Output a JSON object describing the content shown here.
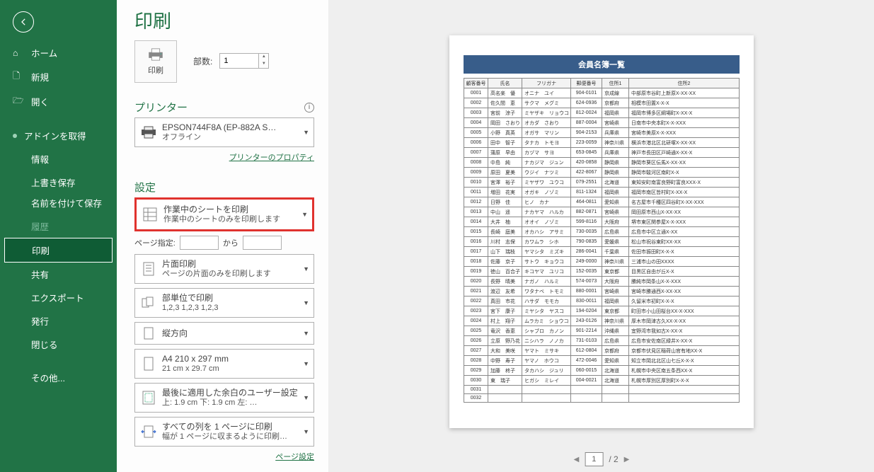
{
  "page_title": "印刷",
  "sidebar": {
    "home": "ホーム",
    "new": "新規",
    "open": "開く",
    "addin": "アドインを取得",
    "info": "情報",
    "save": "上書き保存",
    "saveas": "名前を付けて保存",
    "history": "履歴",
    "print": "印刷",
    "share": "共有",
    "export": "エクスポート",
    "publish": "発行",
    "close": "閉じる",
    "other": "その他..."
  },
  "print_button_label": "印刷",
  "copies": {
    "label": "部数:",
    "value": "1"
  },
  "printer_section": "プリンター",
  "printer": {
    "name": "EPSON744F8A (EP-882A S…",
    "status": "オフライン"
  },
  "printer_props_link": "プリンターのプロパティ",
  "settings_section": "設定",
  "print_what": {
    "l1": "作業中のシートを印刷",
    "l2": "作業中のシートのみを印刷します"
  },
  "pages": {
    "label": "ページ指定:",
    "from": "",
    "to_word": "から",
    "to": ""
  },
  "duplex": {
    "l1": "片面印刷",
    "l2": "ページの片面のみを印刷します"
  },
  "collate": {
    "l1": "部単位で印刷",
    "l2": "1,2,3     1,2,3     1,2,3"
  },
  "orientation": {
    "l1": "縦方向",
    "l2": ""
  },
  "paper": {
    "l1": "A4 210 x 297 mm",
    "l2": "21 cm x 29.7 cm"
  },
  "margins": {
    "l1": "最後に適用した余白のユーザー設定",
    "l2": "上: 1.9 cm 下: 1.9 cm 左: …"
  },
  "scaling": {
    "l1": "すべての列を 1 ページに印刷",
    "l2": "幅が 1 ページに収まるように印刷…"
  },
  "page_setup_link": "ページ設定",
  "pager": {
    "current": "1",
    "total": "2"
  },
  "doc": {
    "title": "会員名簿一覧",
    "headers": [
      "顧客番号",
      "氏名",
      "フリガナ",
      "郵便番号",
      "住所1",
      "住所2"
    ],
    "rows": [
      [
        "0001",
        "高名楽　優",
        "オニナ　ユイ",
        "904-0101",
        "京成線",
        "中部原市谷町上新原X-XX-XX"
      ],
      [
        "0002",
        "佐久間　恵",
        "サクマ　メグミ",
        "624-0936",
        "京都府",
        "相模市田置X-X-X"
      ],
      [
        "0003",
        "宮前　涼子",
        "ミヤザキ　リョウコ",
        "812-0024",
        "福岡県",
        "福岡市博多区綱場町X-XX-X"
      ],
      [
        "0004",
        "岡田　さおり",
        "オカダ　さおり",
        "887-0004",
        "宮崎県",
        "日南市中央本町X-X-XXX"
      ],
      [
        "0005",
        "小野　真英",
        "オガサ　マリン",
        "904-2153",
        "兵庫県",
        "宮崎市美原X-X-XXX"
      ],
      [
        "0006",
        "田中　智子",
        "タナカ　トモヨ",
        "223-0059",
        "神奈川県",
        "横浜市港北区北研塚X-XX-XX"
      ],
      [
        "0007",
        "蒲原　早由",
        "カヅマ　サヨ",
        "653-0845",
        "兵庫県",
        "神戸市長田区戸崎通X-XX-X"
      ],
      [
        "0008",
        "中島　純",
        "ナカジマ　ジュン",
        "420-0858",
        "静岡県",
        "静岡市葵区伝馬X-XX-XX"
      ],
      [
        "0009",
        "原田　夏美",
        "ウジイ　ナツミ",
        "422-8067",
        "静岡県",
        "静岡市駿河区南町X-X"
      ],
      [
        "0010",
        "宮澤　裕子",
        "ミヤザワ　ユウコ",
        "079-2551",
        "北海道",
        "東知安町南富良野町富良XXX-X"
      ],
      [
        "0011",
        "増田　花実",
        "オガキ　ノゾミ",
        "811-1324",
        "福岡県",
        "福岡市南区皆村町X-XX-X"
      ],
      [
        "0012",
        "日野　佳",
        "ヒノ　カナ",
        "464-0811",
        "愛知県",
        "名古屋市千種区四谷町X-XX-XXX"
      ],
      [
        "0013",
        "中山　遥",
        "ナカヤマ　ハルカ",
        "882-0871",
        "宮崎県",
        "岡田原市西山X-XX-XX"
      ],
      [
        "0014",
        "大井　柚",
        "オオイ　ノゾミ",
        "599-8116",
        "大阪府",
        "堺市東区関参屋X-X-XXX"
      ],
      [
        "0015",
        "長崎　庭美",
        "オカハシ　アサミ",
        "730-0035",
        "広島県",
        "広島市中区立通X-XX"
      ],
      [
        "0016",
        "川村　志保",
        "カワムラ　シホ",
        "790-0835",
        "愛媛県",
        "松山市祝谷東町XX-XX"
      ],
      [
        "0017",
        "山下　瑞枝",
        "ヤマシタ　ミズキ",
        "286-0041",
        "千葉県",
        "佐田市振田町X-X-X"
      ],
      [
        "0018",
        "佐藤　京子",
        "サトウ　キョウコ",
        "249-0000",
        "神奈川県",
        "三浦市山の田XXXX"
      ],
      [
        "0019",
        "徳山　百合子",
        "キコヤマ　ユリコ",
        "152-0035",
        "東京都",
        "目黒区自由が丘X-X"
      ],
      [
        "0020",
        "長野　晴美",
        "ナガノ　ハルミ",
        "574-0073",
        "大阪府",
        "勝純市岡条山X-X-XXX"
      ],
      [
        "0021",
        "渡辺　友希",
        "ワタナベ　トモミ",
        "880-0001",
        "宮崎県",
        "宮崎市勝通西X-XX-XX"
      ],
      [
        "0022",
        "真田　市花",
        "ハサダ　モモカ",
        "830-0011",
        "福岡県",
        "久留米市初町X-X-X"
      ],
      [
        "0023",
        "宮下　康子",
        "ミヤシタ　ヤスコ",
        "194-0204",
        "東京都",
        "町田市小山田桜台XX-X-XXX"
      ],
      [
        "0024",
        "村上　翔子",
        "ムラカミ　ショウコ",
        "243-0126",
        "神奈川県",
        "厚木市岡津古久XX-X-XX"
      ],
      [
        "0025",
        "竜沢　香恵",
        "シャブロ　カノン",
        "901-2214",
        "沖縄県",
        "宜野湾市我如古X-XX-X"
      ],
      [
        "0026",
        "立原　野乃花",
        "ニシハラ　ノノカ",
        "731-0103",
        "広島県",
        "広島市安佐南区緑井X-XX-X"
      ],
      [
        "0027",
        "大和　美咲",
        "ヤマト　ミサキ",
        "612-0804",
        "京都府",
        "京都市伏見区稲荷山官有地XX-X"
      ],
      [
        "0028",
        "中野　寿子",
        "ヤマノ　ホウコ",
        "472-0046",
        "愛知県",
        "知立市岡北北区山七丘X-X-X"
      ],
      [
        "0029",
        "加藤　柊子",
        "タカハシ　ジュリ",
        "060-0015",
        "北海道",
        "札幌市中央区南五条西XX-X"
      ],
      [
        "0030",
        "東　瑞子",
        "ヒガシ　ミレイ",
        "004-0021",
        "北海道",
        "札幌市厚別区厚別町X-X-X"
      ],
      [
        "0031",
        "",
        "",
        "",
        "",
        ""
      ],
      [
        "0032",
        "",
        "",
        "",
        "",
        ""
      ]
    ]
  }
}
